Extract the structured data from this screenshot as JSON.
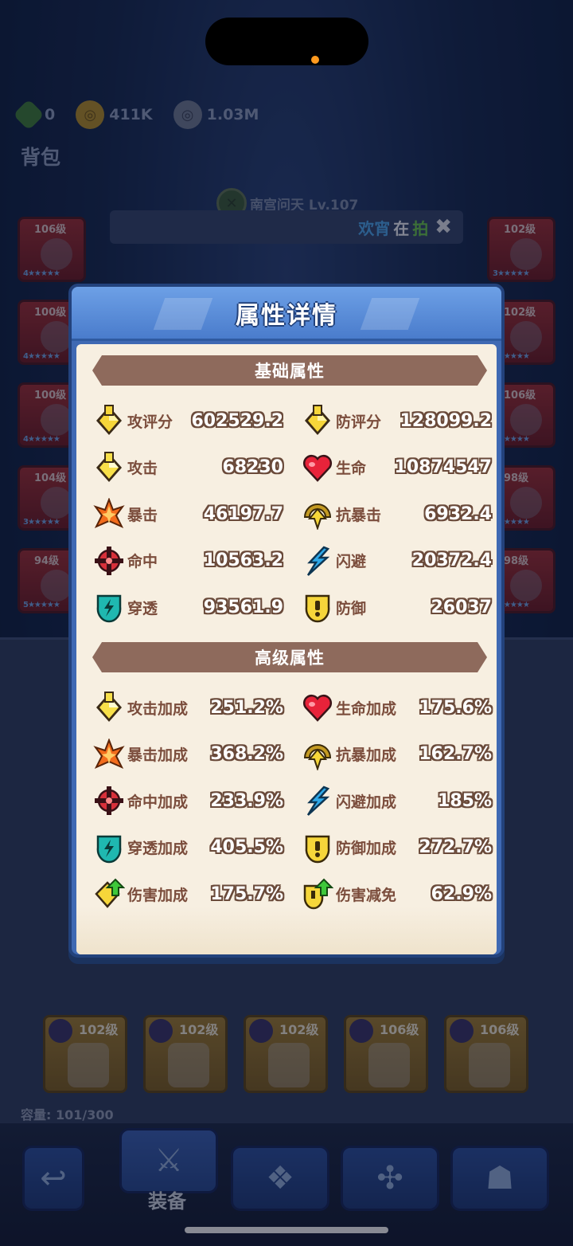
{
  "currencies": [
    {
      "icon": "green-gem-icon",
      "value": "0"
    },
    {
      "icon": "gold-coin-icon",
      "value": "411K"
    },
    {
      "icon": "silver-coin-icon",
      "value": "1.03M"
    }
  ],
  "bag_title": "背包",
  "character": {
    "name": "南宫问天 Lv.107"
  },
  "chat": {
    "part1": "欢宵",
    "part2": "在",
    "part3": "拍",
    "close": "✖"
  },
  "side_slots_left": [
    {
      "level": "106级",
      "stars": "4★★★★★"
    },
    {
      "level": "100级",
      "stars": "4★★★★★"
    },
    {
      "level": "100级",
      "stars": "4★★★★★"
    },
    {
      "level": "104级",
      "stars": "3★★★★★"
    },
    {
      "level": "94级",
      "stars": "5★★★★★"
    }
  ],
  "side_slots_right": [
    {
      "level": "102级",
      "stars": "3★★★★★"
    },
    {
      "level": "102级",
      "stars": "4★★★★★"
    },
    {
      "level": "106级",
      "stars": "4★★★★★"
    },
    {
      "level": "98级",
      "stars": "5★★★★★"
    },
    {
      "level": "98级",
      "stars": "5★★★★★"
    }
  ],
  "bottom_items": [
    {
      "level": "102级"
    },
    {
      "level": "102级"
    },
    {
      "level": "102级"
    },
    {
      "level": "106级"
    },
    {
      "level": "106级"
    }
  ],
  "capacity": "容量: 101/300",
  "nav": {
    "active_label": "装备"
  },
  "modal": {
    "title": "属性详情",
    "basic_title": "基础属性",
    "advanced_title": "高级属性",
    "basic": [
      {
        "name": "攻评分",
        "value": "602529.2",
        "icon": "attack-score-icon"
      },
      {
        "name": "防评分",
        "value": "128099.2",
        "icon": "defense-score-icon"
      },
      {
        "name": "攻击",
        "value": "68230",
        "icon": "attack-icon"
      },
      {
        "name": "生命",
        "value": "10874547",
        "icon": "heart-icon"
      },
      {
        "name": "暴击",
        "value": "46197.7",
        "icon": "crit-icon"
      },
      {
        "name": "抗暴击",
        "value": "6932.4",
        "icon": "crit-resist-icon"
      },
      {
        "name": "命中",
        "value": "10563.2",
        "icon": "hit-icon"
      },
      {
        "name": "闪避",
        "value": "20372.4",
        "icon": "dodge-icon"
      },
      {
        "name": "穿透",
        "value": "93561.9",
        "icon": "penetration-icon"
      },
      {
        "name": "防御",
        "value": "26037",
        "icon": "defense-icon"
      }
    ],
    "advanced": [
      {
        "name": "攻击加成",
        "value": "251.2%",
        "icon": "attack-icon"
      },
      {
        "name": "生命加成",
        "value": "175.6%",
        "icon": "heart-icon"
      },
      {
        "name": "暴击加成",
        "value": "368.2%",
        "icon": "crit-icon"
      },
      {
        "name": "抗暴加成",
        "value": "162.7%",
        "icon": "crit-resist-icon"
      },
      {
        "name": "命中加成",
        "value": "233.9%",
        "icon": "hit-icon"
      },
      {
        "name": "闪避加成",
        "value": "185%",
        "icon": "dodge-icon"
      },
      {
        "name": "穿透加成",
        "value": "405.5%",
        "icon": "penetration-icon"
      },
      {
        "name": "防御加成",
        "value": "272.7%",
        "icon": "defense-icon"
      },
      {
        "name": "伤害加成",
        "value": "175.7%",
        "icon": "damage-bonus-icon"
      },
      {
        "name": "伤害减免",
        "value": "62.9%",
        "icon": "damage-reduction-icon"
      }
    ]
  },
  "colors": {
    "modal_frame": "#3f69b3",
    "modal_body": "#f7efe1",
    "banner": "#8e6a5c",
    "stat_name": "#7b4d3c",
    "stat_value_outline": "#6a4a3a"
  }
}
